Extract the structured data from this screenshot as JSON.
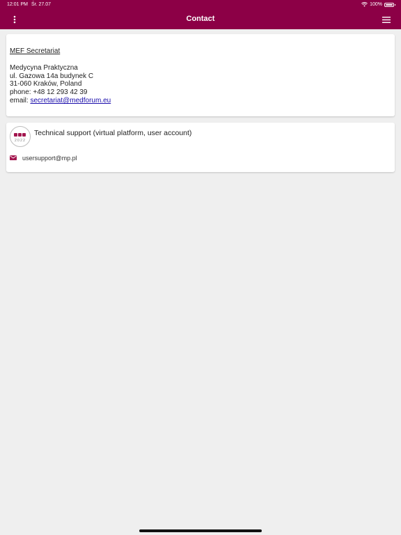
{
  "status_bar": {
    "time": "12:01 PM",
    "date": "Śr. 27.07",
    "battery": "100%"
  },
  "header": {
    "title": "Contact",
    "more_icon": "more-vertical-icon",
    "menu_icon": "hamburger-menu-icon"
  },
  "secretariat": {
    "heading": "MEF Secretariat ",
    "organization": "Medycyna Praktyczna",
    "street": "ul. Gazowa 14a budynek C",
    "city": "31-060 Kraków, Poland",
    "phone": "phone: +48 12 293 42 39",
    "email_label": "email: ",
    "email": "secretariat@medforum.eu"
  },
  "support": {
    "logo_text": "2022",
    "title": "Technical support (virtual platform, user account)",
    "email_icon": "mail-icon",
    "email": "usersupport@mp.pl"
  },
  "colors": {
    "primary": "#8c0046",
    "background": "#efefef",
    "link": "#1a0dab"
  }
}
